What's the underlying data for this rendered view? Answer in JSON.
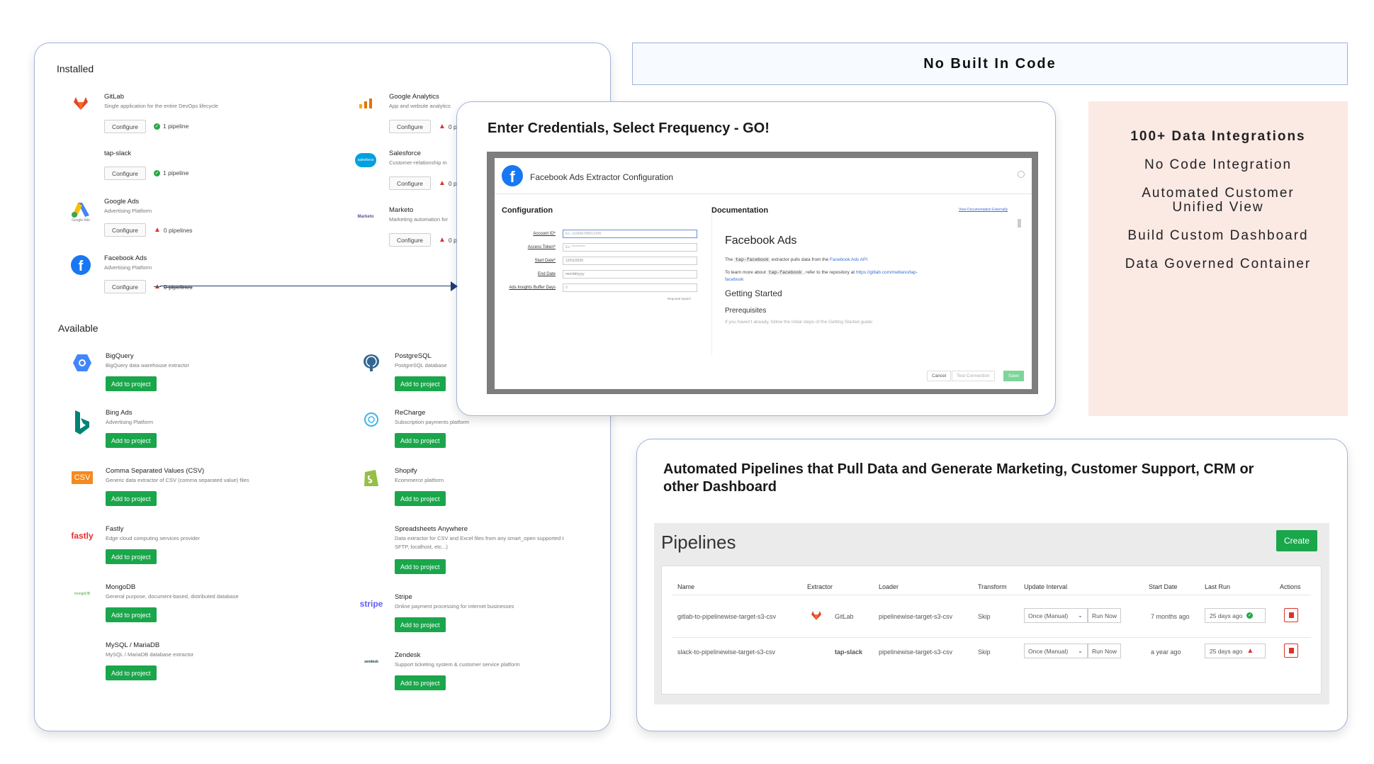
{
  "installed": {
    "title": "Installed",
    "items": [
      {
        "name": "GitLab",
        "desc": "Single application for the entire DevOps lifecycle",
        "button": "Configure",
        "status": "1 pipeline",
        "state": "ok",
        "icon": "gitlab-icon"
      },
      {
        "name": "tap-slack",
        "desc": "",
        "button": "Configure",
        "status": "1 pipeline",
        "state": "ok",
        "icon": "none"
      },
      {
        "name": "Google Ads",
        "desc": "Advertising Platform",
        "button": "Configure",
        "status": "0 pipelines",
        "state": "warn",
        "icon": "google-ads-icon",
        "logo_caption": "Google Ads"
      },
      {
        "name": "Facebook Ads",
        "desc": "Advertising Platform",
        "button": "Configure",
        "status": "0 pipelines",
        "state": "warn",
        "icon": "facebook-icon"
      },
      {
        "name": "Google Analytics",
        "desc": "App and website analytics",
        "button": "Configure",
        "status": "0 pi",
        "state": "warn",
        "icon": "google-analytics-icon"
      },
      {
        "name": "Salesforce",
        "desc": "Customer-relationship m",
        "button": "Configure",
        "status": "0 p",
        "state": "warn",
        "icon": "salesforce-icon",
        "logo_text": "salesforce"
      },
      {
        "name": "Marketo",
        "desc": "Marketing automation for",
        "button": "Configure",
        "status": "0 p",
        "state": "warn",
        "icon": "marketo-icon",
        "logo_text": "Marketo"
      }
    ]
  },
  "available": {
    "title": "Available",
    "add_label": "Add to project",
    "items": [
      {
        "name": "BigQuery",
        "desc": "BigQuery data warehouse extractor",
        "icon": "bigquery-icon"
      },
      {
        "name": "Bing Ads",
        "desc": "Advertising Platform",
        "icon": "bing-icon"
      },
      {
        "name": "Comma Separated Values (CSV)",
        "desc": "Generic data extractor of CSV (comma separated value) files",
        "icon": "csv-icon",
        "logo_text": "CSV"
      },
      {
        "name": "Fastly",
        "desc": "Edge cloud computing services provider",
        "icon": "fastly-icon",
        "logo_text": "fastly"
      },
      {
        "name": "MongoDB",
        "desc": "General purpose, document-based, distributed database",
        "icon": "mongodb-icon",
        "logo_text": "mongoDB"
      },
      {
        "name": "MySQL / MariaDB",
        "desc": "MySQL / MariaDB database extractor",
        "icon": "none"
      },
      {
        "name": "PostgreSQL",
        "desc": "PostgreSQL database",
        "icon": "postgresql-icon"
      },
      {
        "name": "ReCharge",
        "desc": "Subscription payments platform",
        "icon": "recharge-icon"
      },
      {
        "name": "Shopify",
        "desc": "Ecommerce platform",
        "icon": "shopify-icon"
      },
      {
        "name": "Spreadsheets Anywhere",
        "desc": "Data extractor for CSV and Excel files from any smart_open supported t",
        "desc2": "SFTP, localhost, etc...)",
        "icon": "none"
      },
      {
        "name": "Stripe",
        "desc": "Online payment processing for internet businesses",
        "icon": "stripe-icon",
        "logo_text": "stripe"
      },
      {
        "name": "Zendesk",
        "desc": "Support ticketing system & customer service platform",
        "icon": "zendesk-icon",
        "logo_text": "zendesk"
      }
    ]
  },
  "banner": {
    "text": "No Built In Code"
  },
  "config_panel": {
    "heading": "Enter Credentials, Select Frequency - GO!",
    "modal_title": "Facebook Ads Extractor Configuration",
    "configuration_label": "Configuration",
    "documentation_label": "Documentation",
    "view_docs_link": "View Documentation Externally",
    "fields": [
      {
        "label": "Account ID*",
        "placeholder": "Ex. 123456789012345"
      },
      {
        "label": "Access Token*",
        "placeholder": "Ex. **********"
      },
      {
        "label": "Start Date*",
        "placeholder": "12/01/2020"
      },
      {
        "label": "End Date",
        "placeholder": "mm/dd/yyyy"
      },
      {
        "label": "Ads Insights Buffer Days",
        "placeholder": "0"
      }
    ],
    "required_note": "Required Inputs*",
    "doc_title": "Facebook Ads",
    "doc_p1_a": "The",
    "doc_p1_code": "tap-facebook",
    "doc_p1_b": "extractor pulls data from the",
    "doc_p1_link": "Facebook Ads API",
    "doc_p2_a": "To learn more about",
    "doc_p2_code": "tap-facebook",
    "doc_p2_b": ", refer to the repository at",
    "doc_p2_link": "https://gitlab.com/meltano/tap-",
    "doc_p2_link2": "facebook",
    "doc_h2": "Getting Started",
    "doc_h3": "Prerequisites",
    "doc_p3": "If you haven't already, follow the initial steps of the Getting Started guide:",
    "cancel": "Cancel",
    "test": "Test Connection",
    "save": "Save"
  },
  "features": {
    "items": [
      {
        "text": "100+ Data Integrations",
        "bold": true
      },
      {
        "text": "No Code Integration",
        "bold": false
      },
      {
        "text": "Automated Customer Unified View",
        "bold": false
      },
      {
        "text": "Build Custom Dashboard",
        "bold": false
      },
      {
        "text": "Data Governed Container",
        "bold": false
      }
    ]
  },
  "pipelines_panel": {
    "heading": "Automated Pipelines that Pull Data and Generate Marketing, Customer Support, CRM or other Dashboard",
    "title": "Pipelines",
    "create": "Create",
    "columns": [
      "Name",
      "Extractor",
      "Loader",
      "Transform",
      "Update Interval",
      "Start Date",
      "Last Run",
      "Actions"
    ],
    "rows": [
      {
        "name": "gitlab-to-pipelinewise-target-s3-csv",
        "extractor": "GitLab",
        "extractor_icon": "gitlab-icon",
        "loader": "pipelinewise-target-s3-csv",
        "transform": "Skip",
        "interval": "Once (Manual)",
        "run_now": "Run Now",
        "start_date": "7 months ago",
        "last_run": "25 days ago",
        "state": "ok"
      },
      {
        "name": "slack-to-pipelinewise-target-s3-csv",
        "extractor": "tap-slack",
        "extractor_icon": "none",
        "loader": "pipelinewise-target-s3-csv",
        "transform": "Skip",
        "interval": "Once (Manual)",
        "run_now": "Run Now",
        "start_date": "a year ago",
        "last_run": "25 days ago",
        "state": "warn"
      }
    ]
  },
  "colors": {
    "accent_green": "#1aa64b",
    "warn_red": "#d9342b",
    "border_blue": "#9fb3d9",
    "feature_bg": "#fbe9e4"
  }
}
